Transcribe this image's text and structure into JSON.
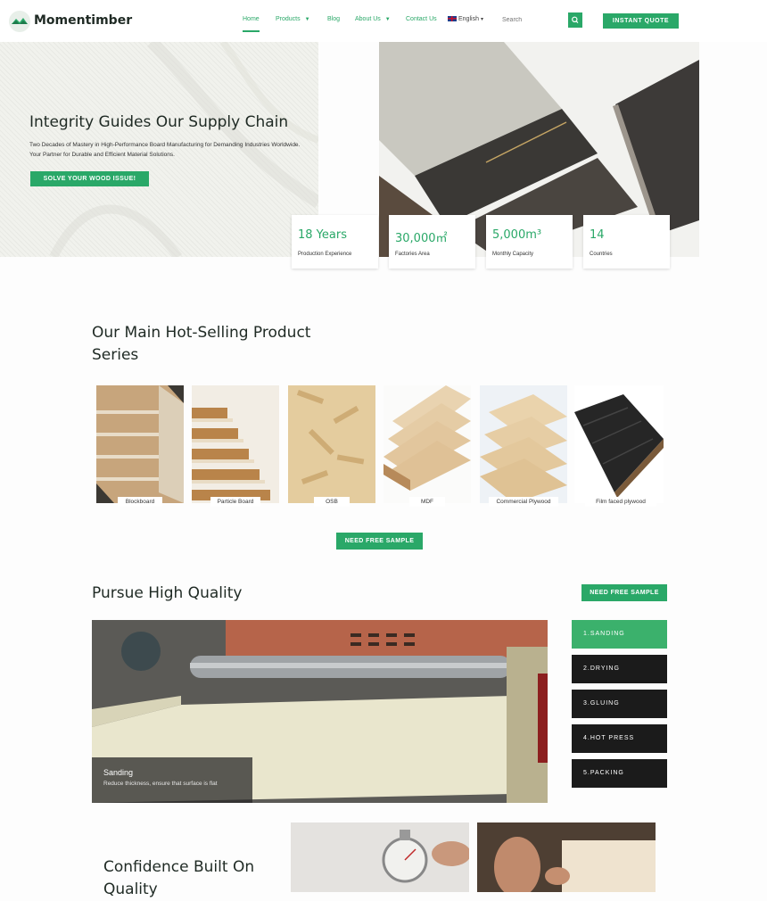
{
  "brand": {
    "name": "Momentimber",
    "accent": "#2aa868"
  },
  "nav": {
    "items": [
      {
        "label": "Home"
      },
      {
        "label": "Products"
      },
      {
        "label": "Blog"
      },
      {
        "label": "About Us"
      },
      {
        "label": "Contact Us"
      }
    ],
    "language": "English",
    "search_placeholder": "Search",
    "quote_label": "INSTANT QUOTE"
  },
  "hero": {
    "title": "Integrity Guides Our Supply Chain",
    "subtitle": "Two Decades of Mastery in High-Performance Board Manufacturing for Demanding Industries Worldwide. Your Partner for Durable and Efficient Material Solutions.",
    "cta": "SOLVE YOUR WOOD ISSUE!"
  },
  "stats": [
    {
      "value": "18 Years",
      "label": "Production Experience"
    },
    {
      "value": "30,000㎡",
      "label": "Factories Area"
    },
    {
      "value": "5,000m³",
      "label": "Monthly Capacity"
    },
    {
      "value": "14",
      "label": "Countries"
    }
  ],
  "products": {
    "title": "Our Main Hot-Selling Product Series",
    "items": [
      {
        "name": "Blockboard"
      },
      {
        "name": "Particle Board"
      },
      {
        "name": "OSB"
      },
      {
        "name": "MDF"
      },
      {
        "name": "Commercial Plywood"
      },
      {
        "name": "Film faced plywood"
      }
    ],
    "cta": "NEED FREE SAMPLE"
  },
  "quality": {
    "title": "Pursue High Quality",
    "cta": "NEED FREE SAMPLE",
    "steps": [
      {
        "label": "1.SANDING"
      },
      {
        "label": "2.DRYING"
      },
      {
        "label": "3.GLUING"
      },
      {
        "label": "4.HOT PRESS"
      },
      {
        "label": "5.PACKING"
      }
    ],
    "caption_title": "Sanding",
    "caption_text": "Reduce thickness, ensure that surface is flat"
  },
  "confidence": {
    "title": "Confidence Built On Quality"
  }
}
